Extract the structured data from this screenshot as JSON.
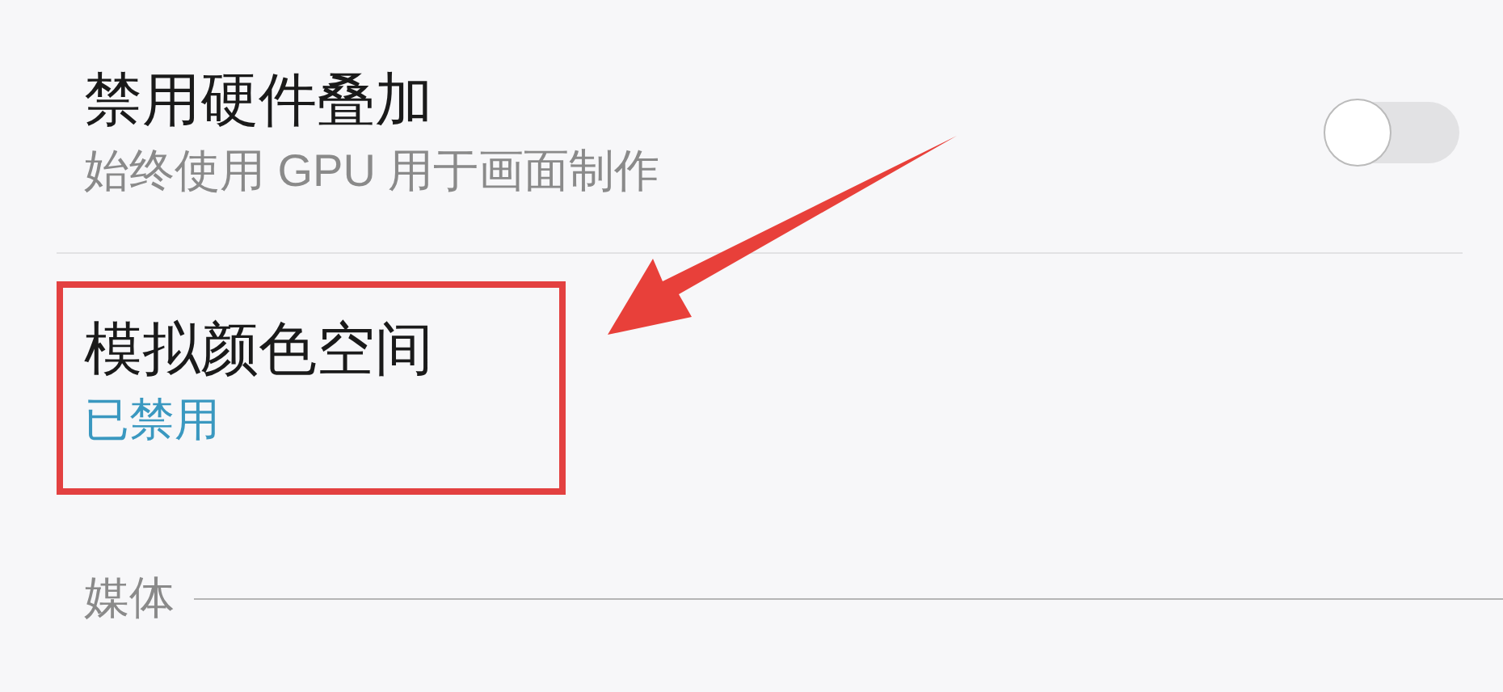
{
  "settings": [
    {
      "kind": "switch",
      "title": "禁用硬件叠加",
      "summary": "始终使用 GPU 用于画面制作",
      "on": false
    },
    {
      "kind": "option",
      "title": "模拟颜色空间",
      "summary": "已禁用",
      "highlighted": true
    }
  ],
  "section": {
    "title": "媒体"
  }
}
